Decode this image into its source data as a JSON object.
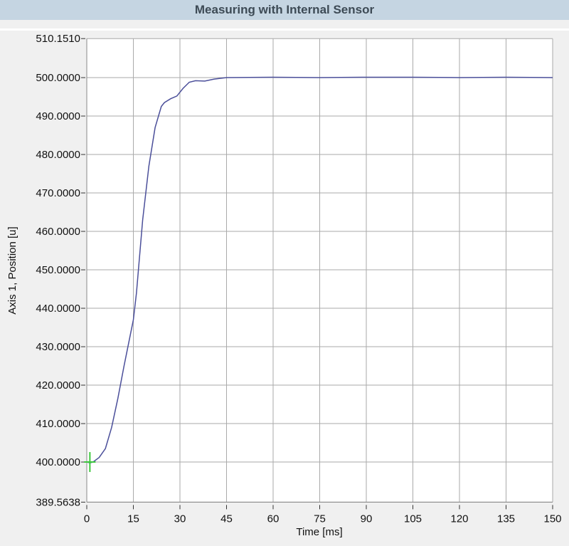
{
  "header": {
    "title": "Measuring with Internal Sensor"
  },
  "chart_data": {
    "type": "line",
    "title": "Measuring with Internal Sensor",
    "xlabel": "Time [ms]",
    "ylabel": "Axis 1, Position [u]",
    "xlim": [
      0,
      150
    ],
    "ylim": [
      389.5638,
      510.151
    ],
    "xticks": [
      "0",
      "15",
      "30",
      "45",
      "60",
      "75",
      "90",
      "105",
      "120",
      "135",
      "150"
    ],
    "yticks": [
      "389.5638",
      "400.0000",
      "410.0000",
      "420.0000",
      "430.0000",
      "440.0000",
      "450.0000",
      "460.0000",
      "470.0000",
      "480.0000",
      "490.0000",
      "500.0000",
      "510.1510"
    ],
    "grid": true,
    "line_color": "#4b4f9a",
    "marker": {
      "x": 1,
      "y": 400,
      "color": "#3cc83c"
    },
    "series": [
      {
        "name": "Axis 1 Position",
        "x": [
          0,
          1,
          2,
          4,
          6,
          8,
          10,
          12,
          14,
          15,
          16,
          18,
          20,
          22,
          24,
          25,
          27,
          29,
          31,
          33,
          35,
          38,
          41,
          45,
          60,
          75,
          90,
          105,
          120,
          135,
          150
        ],
        "y": [
          400,
          399.8,
          400,
          401.2,
          403.5,
          409,
          416.5,
          425,
          433,
          437,
          444,
          463,
          477,
          487,
          492.5,
          493.5,
          494.5,
          495.2,
          497.2,
          498.8,
          499.2,
          499.1,
          499.6,
          500,
          500.1,
          500,
          500.1,
          500.1,
          500,
          500.1,
          500
        ]
      }
    ]
  }
}
